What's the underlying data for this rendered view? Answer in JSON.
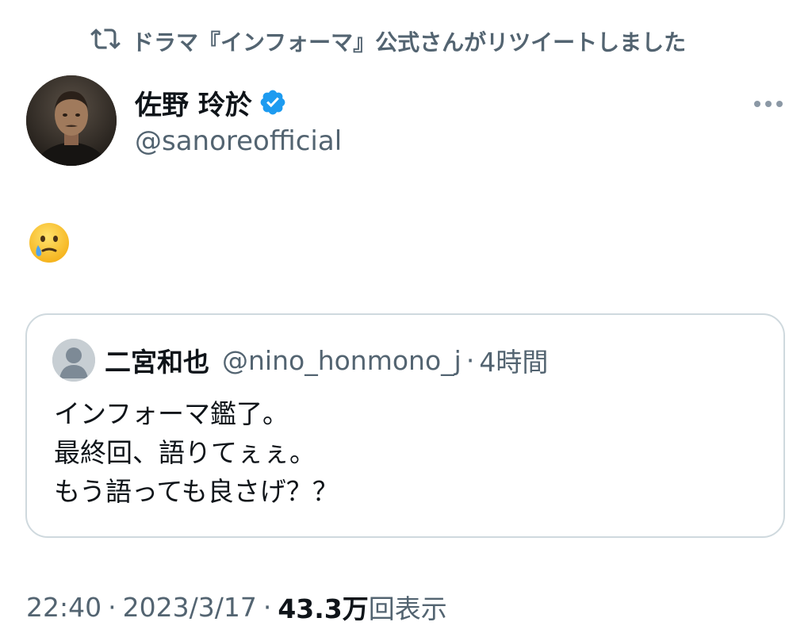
{
  "retweet_banner": {
    "icon": "retweet-icon",
    "text": "ドラマ『インフォーマ』公式さんがリツイートしました"
  },
  "tweet": {
    "author": {
      "name": "佐野 玲於",
      "handle": "@sanoreofficial",
      "verified": true,
      "verified_color": "#1d9bf0"
    },
    "more_icon": "more-horizontal-icon",
    "body_emoji": "face-holding-back-tears-emoji",
    "quoted_tweet": {
      "author_name": "二宮和也",
      "author_handle": "@nino_honmono_j",
      "separator": "·",
      "time": "4時間",
      "lines": [
        "インフォーマ鑑了。",
        "最終回、語りてぇぇ。",
        "もう語っても良さげ？？"
      ]
    },
    "meta": {
      "time": "22:40",
      "separator": "·",
      "date": "2023/3/17",
      "views_count": "43.3万",
      "views_label": "回表示"
    }
  },
  "colors": {
    "text_primary": "#0f1419",
    "text_secondary": "#536471",
    "border": "#cfd9de",
    "accent": "#1d9bf0"
  }
}
